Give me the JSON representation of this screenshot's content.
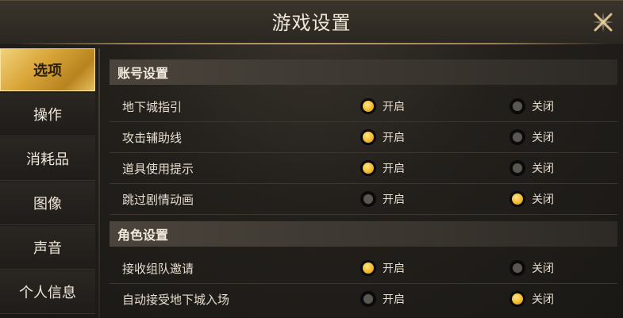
{
  "window": {
    "title": "游戏设置"
  },
  "sidebar": {
    "items": [
      {
        "label": "选项",
        "active": true
      },
      {
        "label": "操作",
        "active": false
      },
      {
        "label": "消耗品",
        "active": false
      },
      {
        "label": "图像",
        "active": false
      },
      {
        "label": "声音",
        "active": false
      },
      {
        "label": "个人信息",
        "active": false
      }
    ]
  },
  "sections": [
    {
      "title": "账号设置",
      "rows": [
        {
          "label": "地下城指引",
          "on_label": "开启",
          "off_label": "关闭",
          "value": "on"
        },
        {
          "label": "攻击辅助线",
          "on_label": "开启",
          "off_label": "关闭",
          "value": "on"
        },
        {
          "label": "道具使用提示",
          "on_label": "开启",
          "off_label": "关闭",
          "value": "on"
        },
        {
          "label": "跳过剧情动画",
          "on_label": "开启",
          "off_label": "关闭",
          "value": "off"
        }
      ]
    },
    {
      "title": "角色设置",
      "rows": [
        {
          "label": "接收组队邀请",
          "on_label": "开启",
          "off_label": "关闭",
          "value": "on"
        },
        {
          "label": "自动接受地下城入场",
          "on_label": "开启",
          "off_label": "关闭",
          "value": "off"
        }
      ]
    }
  ],
  "colors": {
    "accent": "#f2bb2c",
    "panel": "#23201c"
  }
}
